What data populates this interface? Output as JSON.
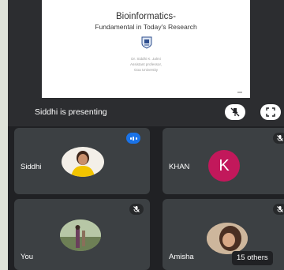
{
  "presentation": {
    "slide": {
      "title": "Bioinformatics-",
      "subtitle": "Fundamental in Today's Research",
      "author_lines": [
        "Dr. Siddhi K. Jalmi",
        "Assistant professor,",
        "Goa University"
      ]
    },
    "status": "Siddhi is presenting"
  },
  "participants": [
    {
      "name": "Siddhi",
      "avatar": "photo",
      "mic": "speaking"
    },
    {
      "name": "KHAN",
      "initial": "K",
      "avatar_color": "#c2185b",
      "mic": "muted"
    },
    {
      "name": "You",
      "avatar": "photo",
      "mic": "muted"
    },
    {
      "name": "Amisha",
      "avatar": "photo",
      "mic": "muted"
    }
  ],
  "others_label": "15 others",
  "icons": {
    "unpin": "unpin-icon",
    "fullscreen": "fullscreen-icon",
    "muted": "mic-off-icon",
    "speaking": "speaking-indicator-icon"
  },
  "colors": {
    "background": "#202124",
    "tile": "#3c4043",
    "speaking_accent": "#1a73e8",
    "khan_avatar": "#c2185b"
  }
}
